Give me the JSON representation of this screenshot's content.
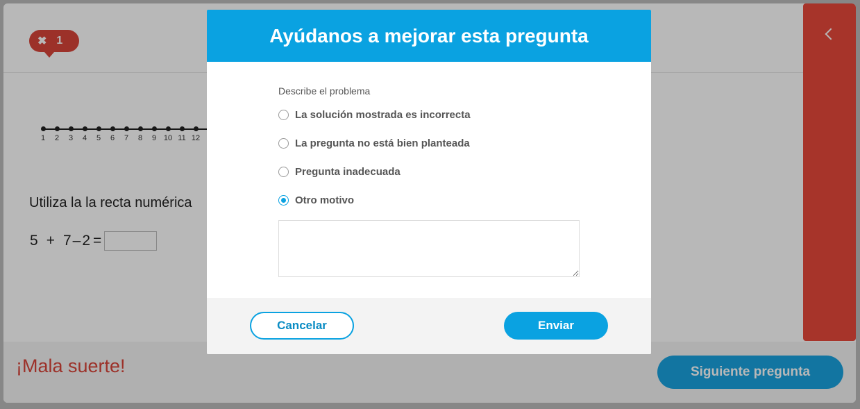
{
  "background": {
    "error_badge": {
      "icon": "close-icon",
      "glyph": "✖",
      "count": "1"
    },
    "number_line": {
      "labels": [
        "1",
        "2",
        "3",
        "4",
        "5",
        "6",
        "7",
        "8",
        "9",
        "10",
        "11",
        "12"
      ]
    },
    "instruction": "Utiliza la la recta numérica",
    "equation": {
      "a": "5",
      "op1": "+",
      "b": "7",
      "op2": "–",
      "c": "2",
      "eq": "="
    },
    "feedback": "¡Mala suerte!",
    "next_button": "Siguiente pregunta"
  },
  "modal": {
    "title": "Ayúdanos a mejorar esta pregunta",
    "describe_label": "Describe el problema",
    "options": [
      {
        "label": "La solución mostrada es incorrecta",
        "checked": false
      },
      {
        "label": "La pregunta no está bien planteada",
        "checked": false
      },
      {
        "label": "Pregunta inadecuada",
        "checked": false
      },
      {
        "label": "Otro motivo",
        "checked": true
      }
    ],
    "comment_value": "",
    "cancel_label": "Cancelar",
    "send_label": "Enviar"
  },
  "colors": {
    "accent": "#0aa2e1",
    "error": "#d9453a",
    "panel": "#e8493b"
  }
}
